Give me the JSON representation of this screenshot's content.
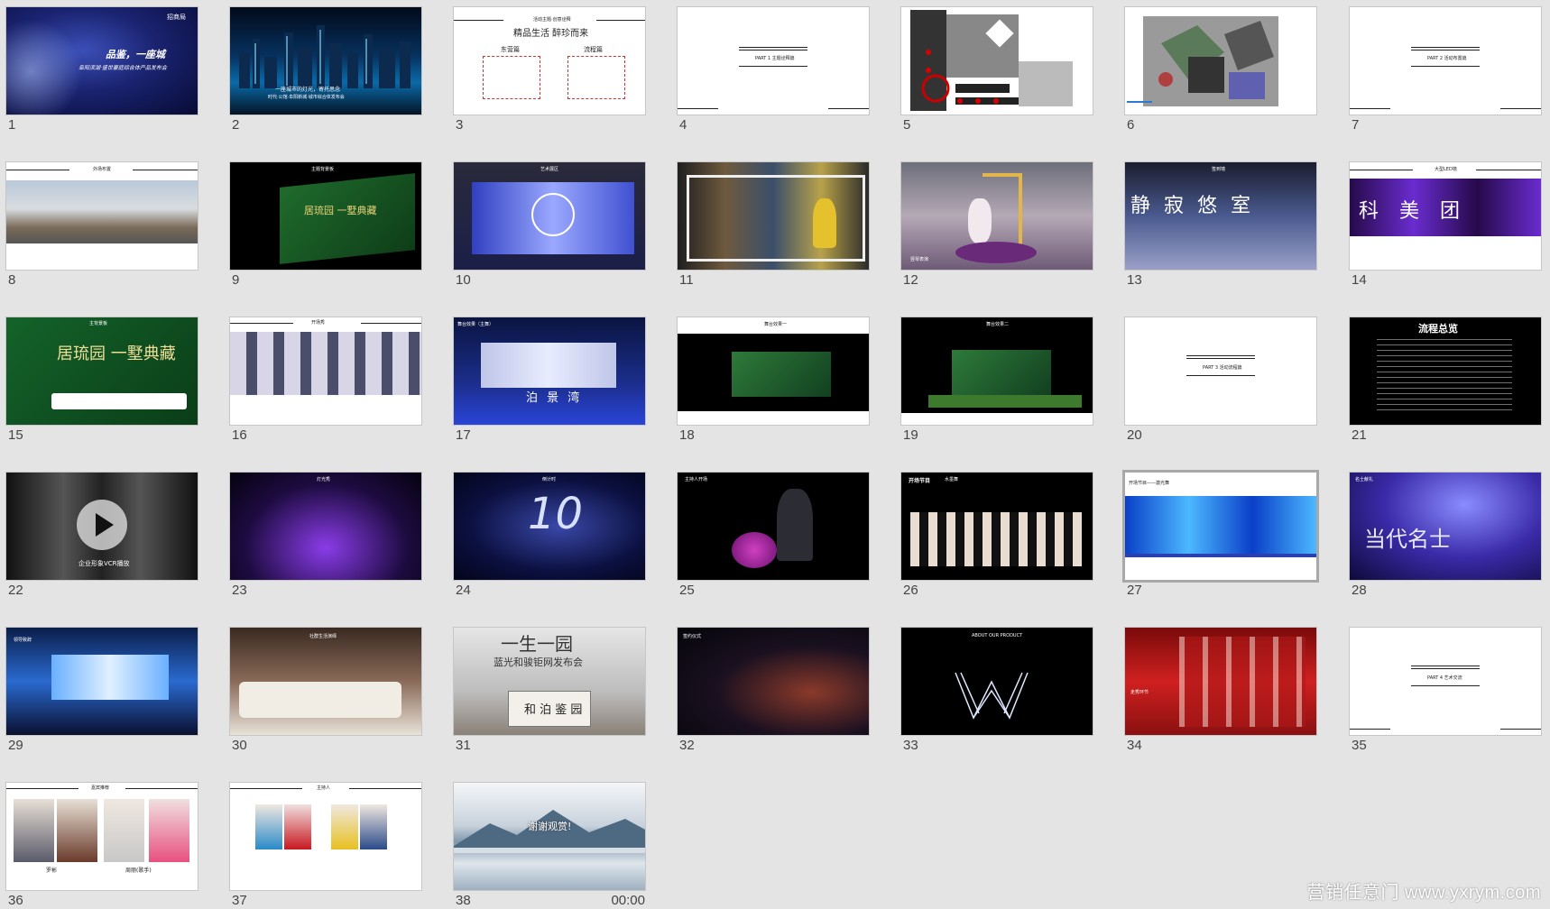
{
  "app": {
    "name": "PowerPoint slide sorter"
  },
  "watermark": "营销任意门 www.yxrym.com",
  "slides": [
    {
      "number": "1",
      "title": "品鉴，一座城",
      "subtitle": "阜阳滨湖·盛世豪庭综合体产品发布会",
      "corner": "招商局"
    },
    {
      "number": "2",
      "title": "一座城市的灯光，寄托思念",
      "subtitle": "时代·公馆·阜阳新城·城市综合体发布会"
    },
    {
      "number": "3",
      "title": "精品生活 醉珍而来",
      "heading": "活动主题·创意诠释",
      "left_label": "东营篇",
      "right_label": "流程篇"
    },
    {
      "number": "4",
      "title": "PART 1 主题诠释篇"
    },
    {
      "number": "5"
    },
    {
      "number": "6"
    },
    {
      "number": "7",
      "title": "PART 2 活动布置篇"
    },
    {
      "number": "8",
      "heading": "外场布置"
    },
    {
      "number": "9",
      "heading": "主题背景板",
      "title": "居琉园 一墅典藏"
    },
    {
      "number": "10",
      "heading": "艺术展区"
    },
    {
      "number": "11"
    },
    {
      "number": "12",
      "caption": "竖琴表演"
    },
    {
      "number": "13",
      "heading": "签到墙",
      "title": "静 寂 悠 室"
    },
    {
      "number": "14",
      "heading": "大型LED墙",
      "title": "科 美 团"
    },
    {
      "number": "15",
      "heading": "主背景板",
      "title": "居琉园 一墅典藏"
    },
    {
      "number": "16",
      "heading": "开场秀"
    },
    {
      "number": "17",
      "title": "泊 景 湾",
      "heading": "舞台效果（主舞）"
    },
    {
      "number": "18",
      "heading": "舞台效果一"
    },
    {
      "number": "19",
      "heading": "舞台效果二"
    },
    {
      "number": "20",
      "title": "PART 3 活动流程篇"
    },
    {
      "number": "21",
      "title": "流程总览"
    },
    {
      "number": "22",
      "caption": "企业形象VCR播放"
    },
    {
      "number": "23",
      "heading": "灯光秀"
    },
    {
      "number": "24",
      "heading": "倒计时",
      "title": "10"
    },
    {
      "number": "25",
      "heading": "主持人开场"
    },
    {
      "number": "26",
      "heading": "开场节目",
      "subtitle": "水墨舞"
    },
    {
      "number": "27",
      "heading": "开场节目——激光舞"
    },
    {
      "number": "28",
      "title": "当代名士",
      "heading": "名士献礼"
    },
    {
      "number": "29",
      "heading": "领导致辞"
    },
    {
      "number": "30",
      "heading": "社群生活演绎"
    },
    {
      "number": "31",
      "title": "一生一园",
      "subtitle": "蓝光和骏钜网发布会",
      "sign": "和 泊 鉴 园"
    },
    {
      "number": "32",
      "heading": "签约仪式"
    },
    {
      "number": "33",
      "heading": "ABOUT OUR PRODUCT"
    },
    {
      "number": "34",
      "heading": "走秀环节"
    },
    {
      "number": "35",
      "title": "PART 4 艺术交流"
    },
    {
      "number": "36",
      "heading": "嘉宾推荐",
      "name_left": "罗彬",
      "name_right": "周丽(歌手)"
    },
    {
      "number": "37",
      "heading": "主持人"
    },
    {
      "number": "38",
      "title": "谢谢观赏!",
      "duration": "00:00"
    }
  ]
}
